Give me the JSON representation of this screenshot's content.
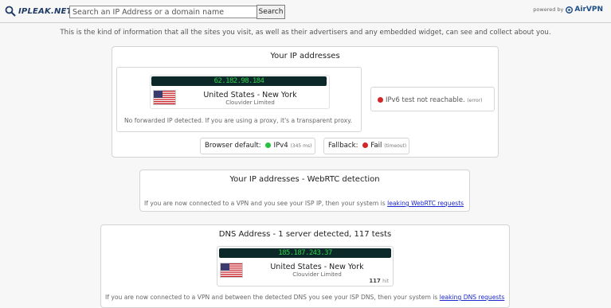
{
  "header": {
    "logo_text": "IPLEAK.NET",
    "search_placeholder": "Search an IP Address or a domain name",
    "search_button": "Search",
    "powered_by": "powered by",
    "powered_brand": "AirVPN"
  },
  "intro": "This is the kind of information that all the sites you visit, as well as their advertisers and any embedded widget, can see and collect about you.",
  "ip_section": {
    "title": "Your IP addresses",
    "ip": "62.182.98.184",
    "location": "United States - New York",
    "isp": "Clouvider Limited",
    "note": "No forwarded IP detected. If you are using a proxy, it's a transparent proxy.",
    "ipv6_text": "IPv6 test not reachable.",
    "ipv6_small": "(error)",
    "browser_default_label": "Browser default:",
    "browser_default_value": "IPv4",
    "browser_default_small": "(345 ms)",
    "fallback_label": "Fallback:",
    "fallback_value": "Fail",
    "fallback_small": "(timeout)"
  },
  "webrtc_section": {
    "title": "Your IP addresses - WebRTC detection",
    "note_text": "If you are now connected to a VPN and you see your ISP IP, then your system is ",
    "note_link": "leaking WebRTC requests"
  },
  "dns_section": {
    "title": "DNS Address - 1 server detected, 117 tests",
    "ip": "185.187.243.37",
    "location": "United States - New York",
    "isp": "Clouvider Limited",
    "hits": "117",
    "hits_label": "hit",
    "note_text": "If you are now connected to a VPN and between the detected DNS you see your ISP DNS, then your system is ",
    "note_link": "leaking DNS requests"
  },
  "colors": {
    "ip_bar_bg": "#0c2828",
    "ip_bar_text": "#2fd24d",
    "link": "#1a27d1",
    "status_red": "#d2262a",
    "status_green": "#27c13f"
  },
  "icons": {
    "logo": "magnifier-icon",
    "brand": "airvpn-logo-icon",
    "flag": "us-flag-icon"
  }
}
